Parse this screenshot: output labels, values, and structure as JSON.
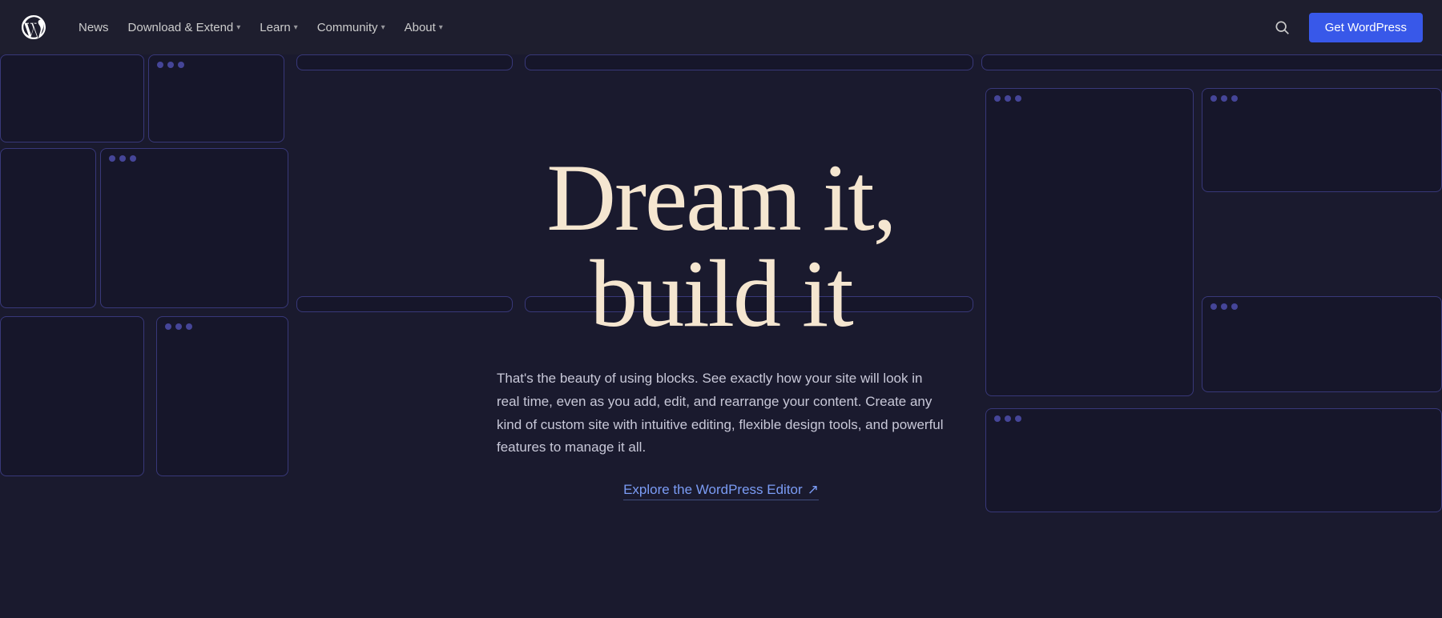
{
  "nav": {
    "logo_alt": "WordPress Logo",
    "links": [
      {
        "id": "news",
        "label": "News",
        "has_dropdown": false
      },
      {
        "id": "download-extend",
        "label": "Download & Extend",
        "has_dropdown": true
      },
      {
        "id": "learn",
        "label": "Learn",
        "has_dropdown": true
      },
      {
        "id": "community",
        "label": "Community",
        "has_dropdown": true
      },
      {
        "id": "about",
        "label": "About",
        "has_dropdown": true
      }
    ],
    "search_aria": "Search",
    "cta_label": "Get WordPress"
  },
  "hero": {
    "title_line1": "Dream it,",
    "title_line2": "build it",
    "description": "That's the beauty of using blocks. See exactly how your site will look in real time, even as you add, edit, and rearrange your content. Create any kind of custom site with intuitive editing, flexible design tools, and powerful features to manage it all.",
    "cta_label": "Explore the WordPress Editor",
    "cta_arrow": "↗"
  },
  "colors": {
    "background": "#1a1a2e",
    "card_border": "rgba(90,90,200,0.5)",
    "nav_bg": "#1e1e2e",
    "cta_bg": "#3858e9",
    "hero_title": "#f5e6d0",
    "hero_desc": "#c8c8d8",
    "hero_link": "#7b9cf5"
  }
}
